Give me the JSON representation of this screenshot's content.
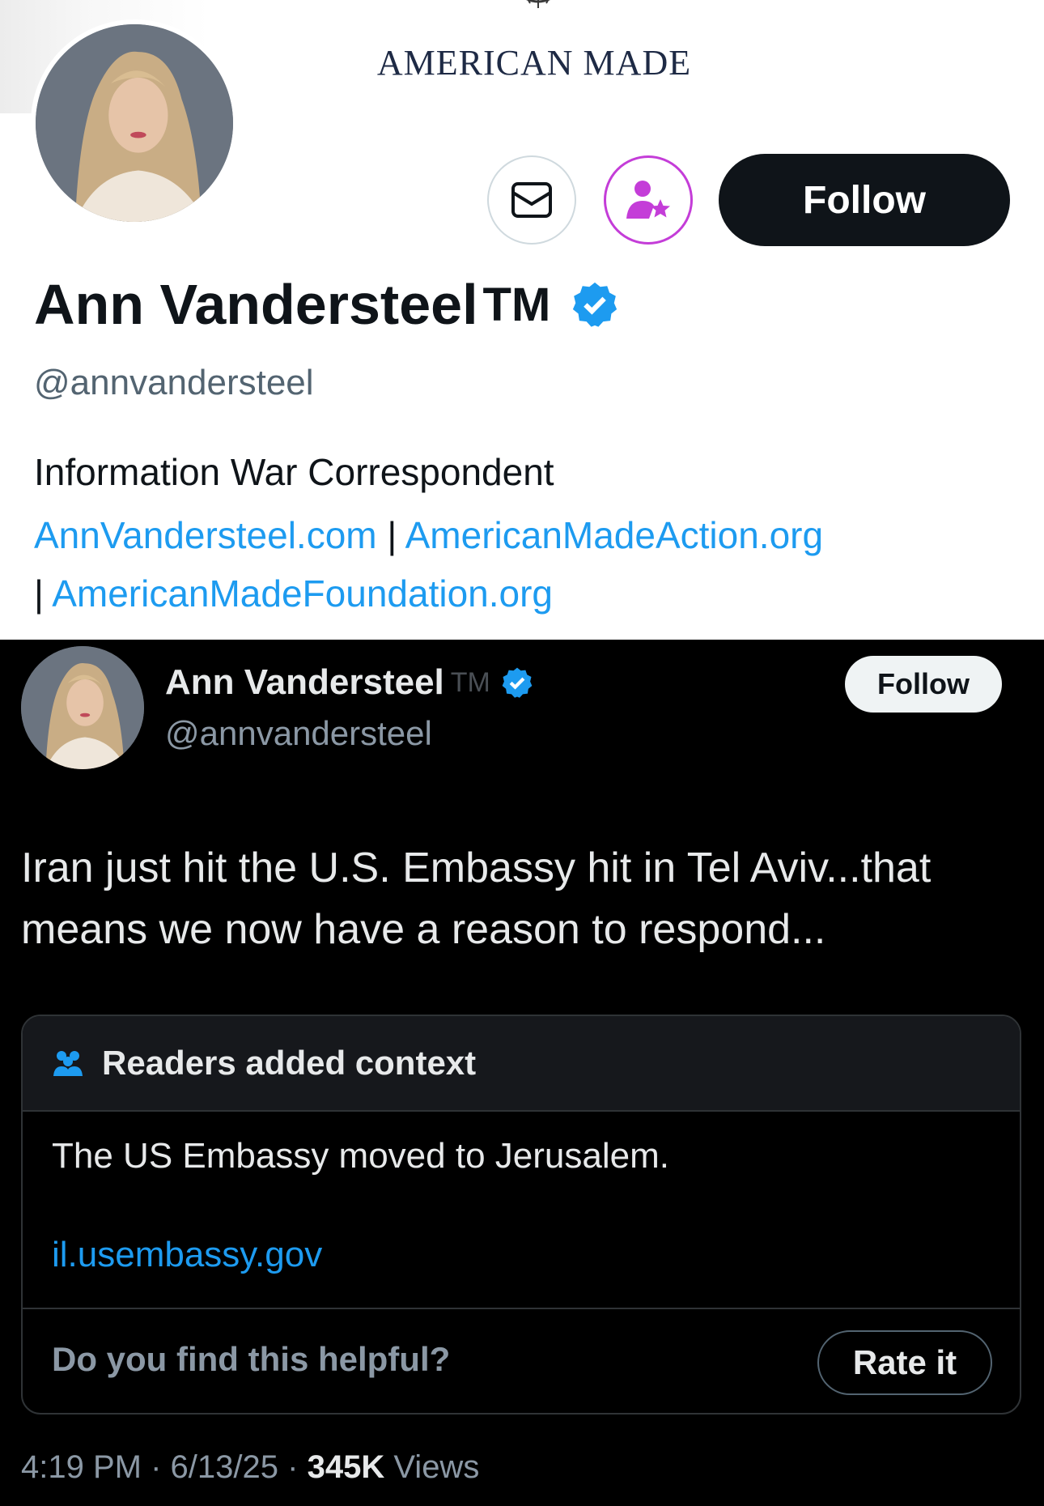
{
  "profile": {
    "banner_title": "AMERICAN MADE",
    "display_name": "Ann Vandersteel",
    "name_suffix": "TM",
    "handle": "@annvandersteel",
    "follow_label": "Follow",
    "bio": "Information War Correspondent",
    "links": [
      "AnnVandersteel.com",
      "AmericanMadeAction.org",
      "AmericanMadeFoundation.org"
    ],
    "link_separator": "|",
    "icons": {
      "message": "envelope-icon",
      "subscribe": "user-star-icon",
      "verified": "verified-badge-icon"
    },
    "colors": {
      "link": "#1d9bf0",
      "verified": "#1d9bf0",
      "subscribe": "#c43dd8",
      "follow_bg": "#0f1419"
    }
  },
  "post": {
    "display_name": "Ann Vandersteel",
    "name_suffix": "TM",
    "handle": "@annvandersteel",
    "follow_label": "Follow",
    "text": "Iran just hit the U.S. Embassy hit in Tel Aviv...that means we now have a reason  to respond...",
    "community_note": {
      "title": "Readers added context",
      "body": "The US Embassy moved to Jerusalem.",
      "link": "il.usembassy.gov",
      "question": "Do you find this helpful?",
      "rate_label": "Rate it",
      "icon": "people-icon"
    },
    "time": "4:19 PM",
    "date": "6/13/25",
    "separator": "·",
    "views_count": "345K",
    "views_label": "Views"
  }
}
